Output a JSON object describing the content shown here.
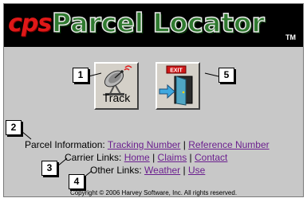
{
  "header": {
    "brand": "cps",
    "title": "Parcel Locator",
    "tm": "TM"
  },
  "toolbar": {
    "track_label": "Track",
    "exit_sign": "EXIT"
  },
  "callouts": [
    "1",
    "2",
    "3",
    "4",
    "5"
  ],
  "parcel_info": {
    "label": "Parcel Information:",
    "tracking_number": "Tracking Number",
    "separator": "|",
    "reference_number": "Reference Number"
  },
  "carrier_links": {
    "label": "Carrier Links:",
    "home": "Home",
    "claims": "Claims",
    "contact": "Contact",
    "separator": "|"
  },
  "other_links": {
    "label": "Other Links:",
    "weather": "Weather",
    "use": "Use",
    "separator": "|"
  },
  "footer": {
    "copyright": "Copyright © 2006 Harvey Software, Inc.  All rights reserved."
  },
  "colors": {
    "banner_bg": "#000000",
    "brand_red": "#e01818",
    "title_green": "#2f7a2f",
    "panel_bg": "#c8c8c8",
    "link": "#6b1f8f"
  }
}
